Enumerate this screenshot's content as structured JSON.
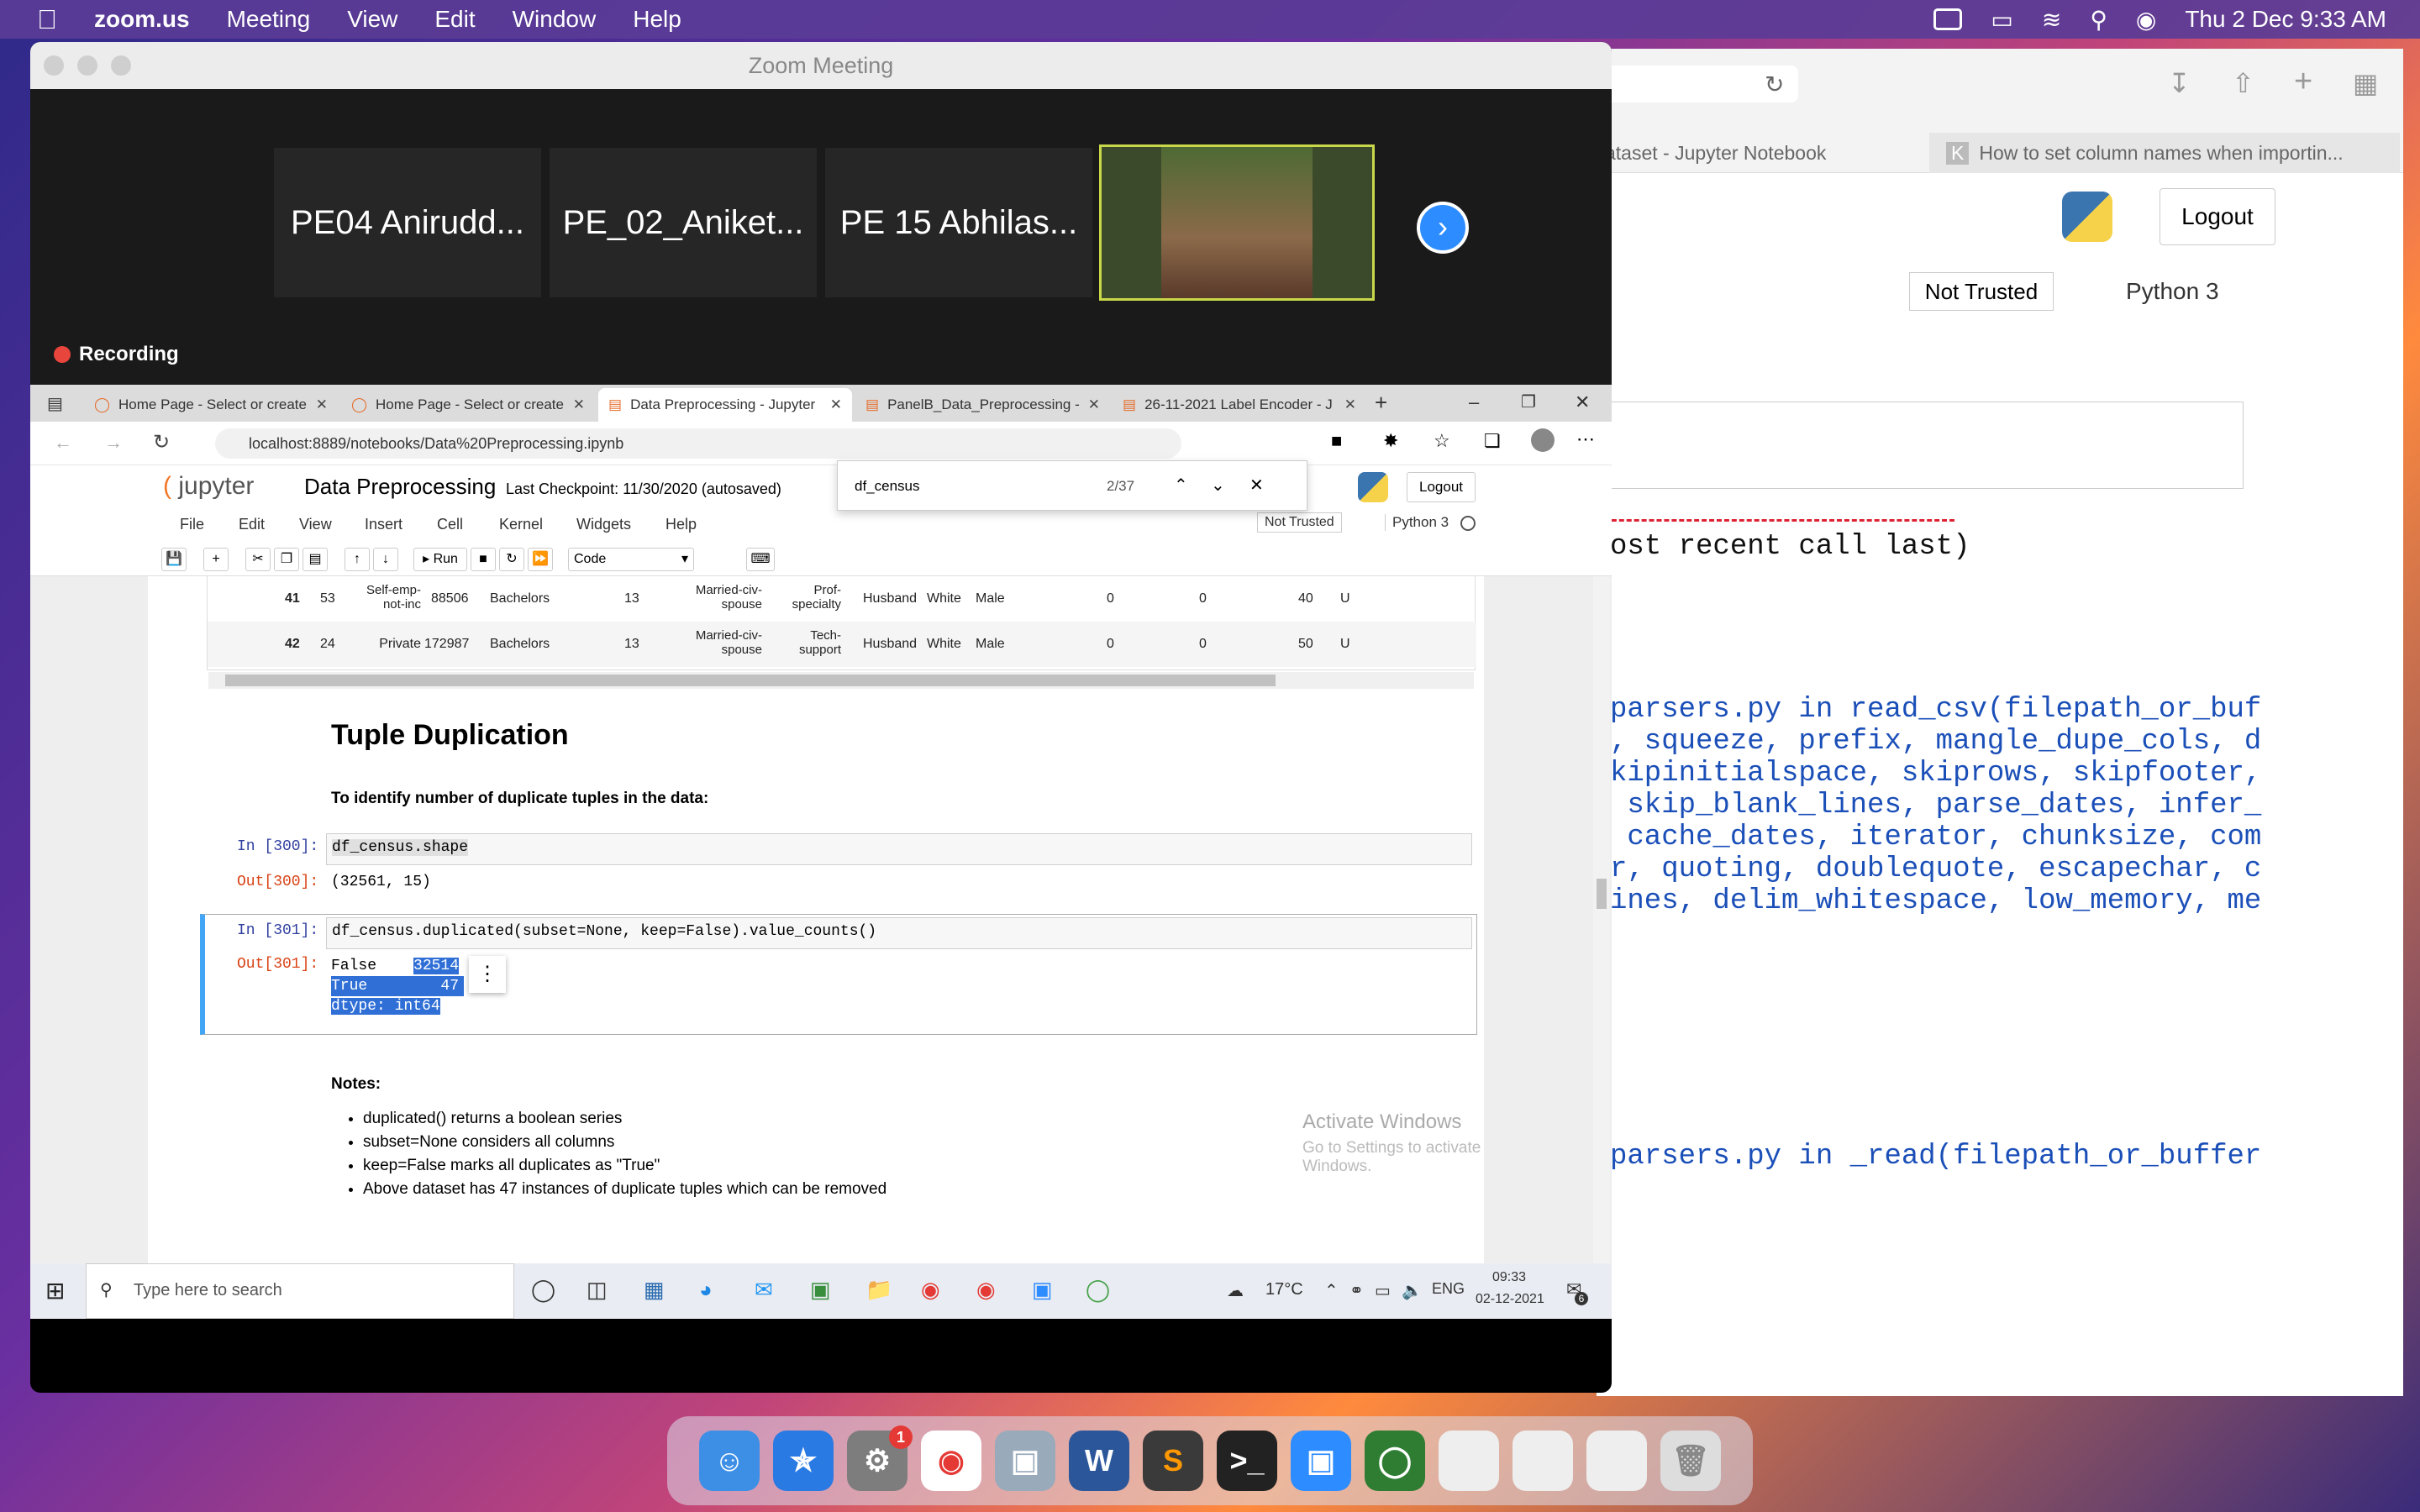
{
  "menubar": {
    "app": "zoom.us",
    "items": [
      "Meeting",
      "View",
      "Edit",
      "Window",
      "Help"
    ],
    "clock": "Thu 2 Dec  9:33 AM"
  },
  "bg": {
    "tab1": "ataset - Jupyter Notebook",
    "tab2": "How to set column names when importin...",
    "logout": "Logout",
    "trusted": "Not Trusted",
    "kernel": "Python 3",
    "code": [
      "ost recent call last)",
      "parsers.py in read_csv(filepath_or_buf",
      ", squeeze, prefix, mangle_dupe_cols, d",
      "kipinitialspace, skiprows, skipfooter,",
      " skip_blank_lines, parse_dates, infer_",
      " cache_dates, iterator, chunksize, com",
      "r, quoting, doublequote, escapechar, c",
      "ines, delim_whitespace, low_memory, me",
      "parsers.py in _read(filepath_or_buffer"
    ]
  },
  "zoom": {
    "title": "Zoom Meeting",
    "participants": [
      "PE04 Anirudd...",
      "PE_02_Aniket...",
      "PE 15 Abhilas..."
    ],
    "recording": "Recording"
  },
  "browser": {
    "tabs": [
      "Home Page - Select or create",
      "Home Page - Select or create",
      "Data Preprocessing - Jupyter",
      "PanelB_Data_Preprocessing -",
      "26-11-2021 Label Encoder - J"
    ],
    "url": "localhost:8889/notebooks/Data%20Preprocessing.ipynb",
    "find_query": "df_census",
    "find_count": "2/37"
  },
  "jupyter": {
    "logo": "jupyter",
    "name": "Data Preprocessing",
    "checkpoint": "Last Checkpoint: 11/30/2020  (autosaved)",
    "logout": "Logout",
    "menu": [
      "File",
      "Edit",
      "View",
      "Insert",
      "Cell",
      "Kernel",
      "Widgets",
      "Help"
    ],
    "trusted": "Not Trusted",
    "kernel": "Python 3",
    "run": "Run",
    "celltype": "Code"
  },
  "table_rows": [
    {
      "idx": "41",
      "age": "53",
      "wc": "Self-emp-not-inc",
      "fnl": "88506",
      "edu": "Bachelors",
      "num": "13",
      "ms": "Married-civ-spouse",
      "occ": "Prof-specialty",
      "rel": "Husband",
      "race": "White",
      "sex": "Male",
      "cg": "0",
      "cl": "0",
      "hpw": "40",
      "nc": "U"
    },
    {
      "idx": "42",
      "age": "24",
      "wc": "Private",
      "fnl": "172987",
      "edu": "Bachelors",
      "num": "13",
      "ms": "Married-civ-spouse",
      "occ": "Tech-support",
      "rel": "Husband",
      "race": "White",
      "sex": "Male",
      "cg": "0",
      "cl": "0",
      "hpw": "50",
      "nc": "U"
    }
  ],
  "nb": {
    "heading": "Tuple Duplication",
    "intro": "To identify number of duplicate tuples in the data:",
    "in300": "In [300]:",
    "code300": "df_census.shape",
    "out300": "Out[300]:",
    "res300": "(32561, 15)",
    "in301": "In [301]:",
    "code301": "df_census.duplicated(subset=None, keep=False).value_counts()",
    "out301": "Out[301]:",
    "res_false": "False",
    "res_false_v": "32514",
    "res_true": "True",
    "res_true_v": "47",
    "res_dtype": "dtype: int64",
    "notes": "Notes:",
    "bullets": [
      "duplicated() returns a boolean series",
      "subset=None considers all columns",
      "keep=False marks all duplicates as \"True\"",
      "Above dataset has 47 instances of duplicate tuples which can be removed"
    ],
    "activate1": "Activate Windows",
    "activate2": "Go to Settings to activate Windows."
  },
  "taskbar": {
    "search": "Type here to search",
    "temp": "17°C",
    "lang": "ENG",
    "time": "09:33",
    "date": "02-12-2021",
    "badge": "6"
  },
  "dock": {
    "badge": "1"
  }
}
